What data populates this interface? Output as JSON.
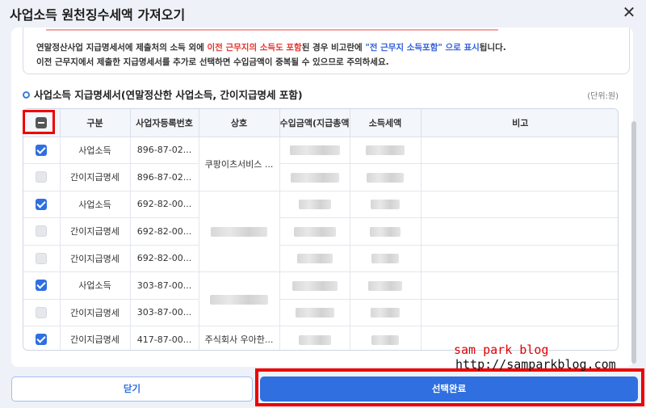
{
  "dialog": {
    "title": "사업소득 원천징수세액 가져오기",
    "close_symbol": "✕"
  },
  "notice": {
    "line1_a": "연말정산사업 지급명세서에 제출처의 소득 외에 ",
    "line1_red": "이전 근무지의 소득도 포함",
    "line1_b": "된 경우 비고란에 ",
    "line1_blue": "\"전 근무지 소득포함\" 으로 표시",
    "line1_c": "됩니다.",
    "line2": "이전 근무지에서 제출한 지급명세서를 추가로 선택하면 수입금액이 중복될 수 있으므로 주의하세요."
  },
  "section": {
    "title": "사업소득 지급명세서(연말정산한 사업소득, 간이지급명세 포함)",
    "unit": "(단위:원)"
  },
  "table": {
    "headers": [
      "",
      "구분",
      "사업자등록번호",
      "상호",
      "수입금액(지급총액)",
      "소득세액",
      "비고"
    ],
    "header_checkbox_state": "partial",
    "rows": [
      {
        "checked": true,
        "type": "사업소득",
        "reg": "896-87-02...",
        "company": ""
      },
      {
        "checked": false,
        "type": "간이지급명세",
        "reg": "896-87-02...",
        "company": ""
      },
      {
        "checked": true,
        "type": "사업소득",
        "reg": "692-82-00...",
        "company": ""
      },
      {
        "checked": false,
        "type": "간이지급명세",
        "reg": "692-82-00...",
        "company": ""
      },
      {
        "checked": false,
        "type": "간이지급명세",
        "reg": "692-82-00...",
        "company": ""
      },
      {
        "checked": true,
        "type": "사업소득",
        "reg": "303-87-00...",
        "company": ""
      },
      {
        "checked": false,
        "type": "간이지급명세",
        "reg": "303-87-00...",
        "company": ""
      },
      {
        "checked": true,
        "type": "간이지급명세",
        "reg": "417-87-00...",
        "company": "주식회사 우아한..."
      }
    ],
    "merged_company_1": "쿠팡이츠서비스 ..."
  },
  "buttons": {
    "close_label": "닫기",
    "confirm_label": "선택완료"
  },
  "watermark": {
    "line1": "sam park blog",
    "line2": "http://samparkblog.com"
  },
  "colors": {
    "accent": "#2f6fe0",
    "highlight": "#e00000",
    "notice_red": "#e3342f",
    "notice_blue": "#2f5fd8"
  }
}
